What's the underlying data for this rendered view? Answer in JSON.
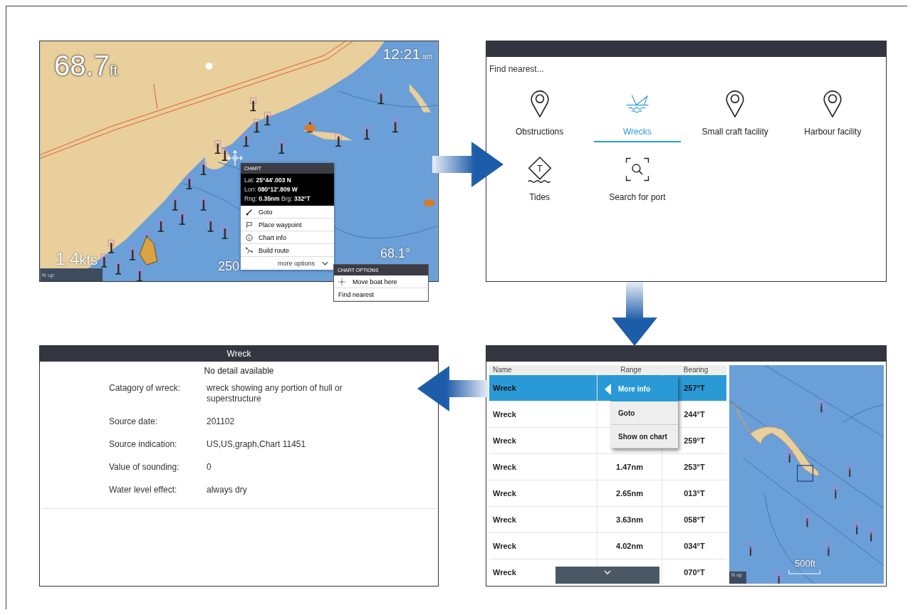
{
  "chart_screen": {
    "depth": {
      "value": "68.7",
      "unit": "ft"
    },
    "time": {
      "value": "12:21",
      "unit": "am"
    },
    "speed": {
      "value": "1.4",
      "unit": "kts"
    },
    "scale": "250",
    "temperature": "68.1°",
    "orientation": "N up",
    "context_menu": {
      "title": "CHART",
      "details": [
        "Lat: **25°44'.003 N**",
        "Lon: **080°12'.809 W**",
        "Rng: **0.35nm** Brg: **332°T**"
      ],
      "items": [
        {
          "label": "Goto",
          "kind": "goto"
        },
        {
          "label": "Place waypoint",
          "kind": "waypoint"
        },
        {
          "label": "Chart info",
          "kind": "info"
        },
        {
          "label": "Build route",
          "kind": "route"
        }
      ],
      "more": "more options"
    },
    "options_menu": {
      "title": "CHART OPTIONS",
      "items": [
        {
          "label": "Move boat here",
          "kind": "boat"
        },
        {
          "label": "Find nearest",
          "kind": "plain"
        }
      ]
    }
  },
  "find_nearest_screen": {
    "heading": "Find nearest...",
    "items": [
      {
        "label": "Obstructions",
        "kind": "pin",
        "selected": false
      },
      {
        "label": "Wrecks",
        "kind": "wreck",
        "selected": true
      },
      {
        "label": "Small craft facility",
        "kind": "pin",
        "selected": false
      },
      {
        "label": "Harbour facility",
        "kind": "pin",
        "selected": false
      },
      {
        "label": "Tides",
        "kind": "tide",
        "badge": "T",
        "selected": false
      },
      {
        "label": "Search for port",
        "kind": "search",
        "selected": false
      }
    ]
  },
  "detail_screen": {
    "title": "Wreck",
    "subtitle": "No detail available",
    "fields": [
      {
        "label": "Catagory of wreck:",
        "value": "wreck showing any portion of hull or superstructure"
      },
      {
        "label": "Source date:",
        "value": "201102"
      },
      {
        "label": "Source indication:",
        "value": "US,US,graph,Chart 11451"
      },
      {
        "label": "Value of sounding:",
        "value": "0"
      },
      {
        "label": "Water level effect:",
        "value": "always dry"
      }
    ]
  },
  "results_screen": {
    "columns": [
      "Name",
      "Range",
      "Bearing"
    ],
    "rows": [
      {
        "name": "Wreck",
        "bearing": "257°T",
        "selected": true
      },
      {
        "name": "Wreck",
        "bearing": "244°T",
        "selected": false
      },
      {
        "name": "Wreck",
        "bearing": "259°T",
        "selected": false
      },
      {
        "name": "Wreck",
        "range": "1.47nm",
        "bearing": "253°T",
        "selected": false
      },
      {
        "name": "Wreck",
        "range": "2.65nm",
        "bearing": "013°T",
        "selected": false
      },
      {
        "name": "Wreck",
        "range": "3.63nm",
        "bearing": "058°T",
        "selected": false
      },
      {
        "name": "Wreck",
        "range": "4.02nm",
        "bearing": "034°T",
        "selected": false
      },
      {
        "name": "Wreck",
        "bearing": "070°T",
        "selected": false
      }
    ],
    "popup": [
      {
        "label": "More info",
        "selected": true
      },
      {
        "label": "Goto",
        "selected": false
      },
      {
        "label": "Show on chart",
        "selected": false
      }
    ],
    "map": {
      "scale": "500ft",
      "orientation": "N up"
    }
  }
}
